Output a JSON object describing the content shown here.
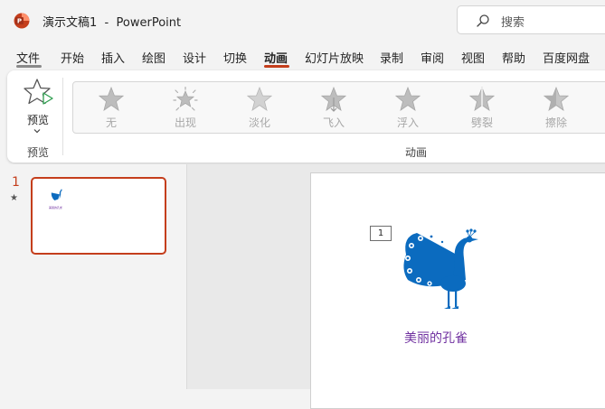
{
  "window": {
    "doc_name": "演示文稿1",
    "separator": "-",
    "app_name": "PowerPoint"
  },
  "search": {
    "placeholder": "搜索"
  },
  "tabs": [
    {
      "label": "文件"
    },
    {
      "label": "开始"
    },
    {
      "label": "插入"
    },
    {
      "label": "绘图"
    },
    {
      "label": "设计"
    },
    {
      "label": "切换"
    },
    {
      "label": "动画"
    },
    {
      "label": "幻灯片放映"
    },
    {
      "label": "录制"
    },
    {
      "label": "审阅"
    },
    {
      "label": "视图"
    },
    {
      "label": "帮助"
    },
    {
      "label": "百度网盘"
    }
  ],
  "active_tab": "动画",
  "ribbon": {
    "preview_label": "预览",
    "preview_group": "预览",
    "animation_group": "动画",
    "animations": [
      {
        "label": "无",
        "icon": "star-none-icon"
      },
      {
        "label": "出现",
        "icon": "star-appear-icon"
      },
      {
        "label": "淡化",
        "icon": "star-fade-icon"
      },
      {
        "label": "飞入",
        "icon": "star-fly-in-icon"
      },
      {
        "label": "浮入",
        "icon": "star-float-in-icon"
      },
      {
        "label": "劈裂",
        "icon": "star-split-icon"
      },
      {
        "label": "擦除",
        "icon": "star-wipe-icon"
      }
    ]
  },
  "thumbnails": {
    "slide_number": "1",
    "animation_marker": "★"
  },
  "slide": {
    "animation_tag": "1",
    "caption": "美丽的孔雀"
  },
  "colors": {
    "accent": "#c43e1c",
    "peacock": "#0b6bbf",
    "caption": "#7030a0"
  }
}
